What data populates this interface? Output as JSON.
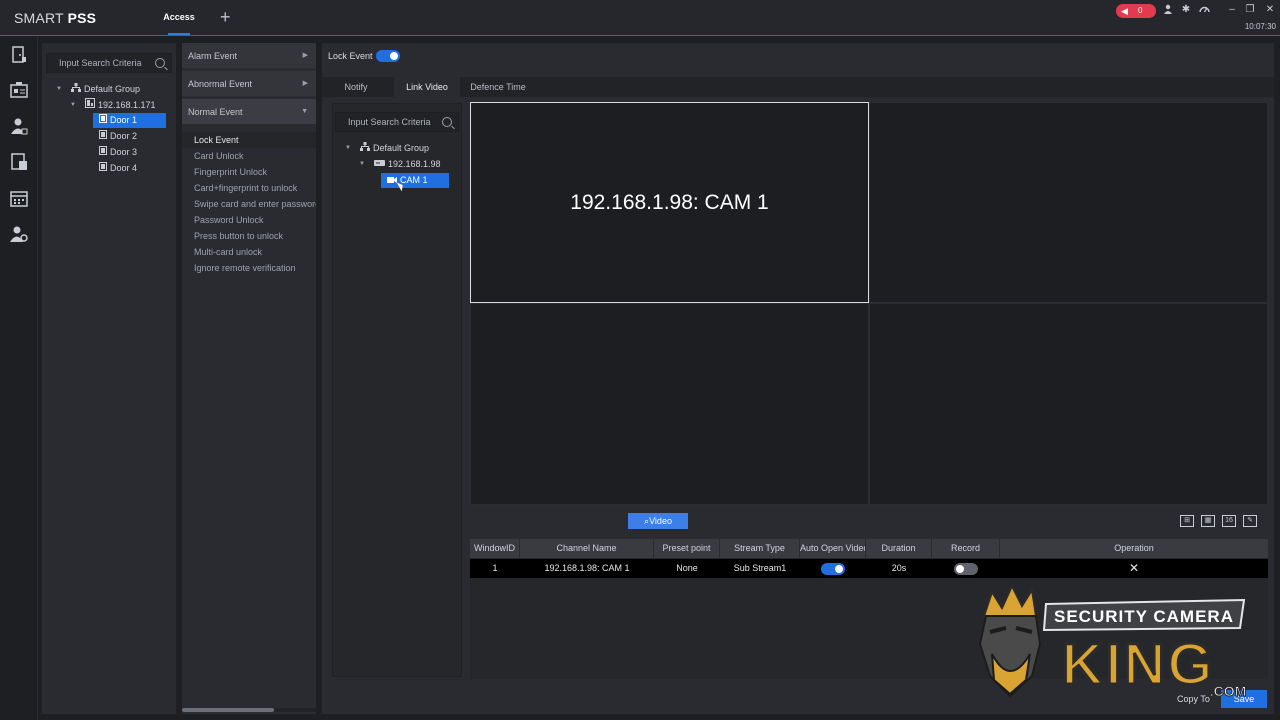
{
  "app": {
    "title_prefix": "SMART",
    "title_suffix": "PSS",
    "active_tab": "Access",
    "alarm_count": "0",
    "time": "10:07:30"
  },
  "device_tree": {
    "search_placeholder": "Input Search Criteria",
    "group": "Default Group",
    "device": "192.168.1.171",
    "doors": [
      "Door 1",
      "Door 2",
      "Door 3",
      "Door 4"
    ]
  },
  "event_panel": {
    "categories": [
      "Alarm Event",
      "Abnormal Event",
      "Normal Event"
    ],
    "items": [
      "Lock Event",
      "Card Unlock",
      "Fingerprint Unlock",
      "Card+fingerprint to unlock",
      "Swipe card and enter password",
      "Password Unlock",
      "Press button to unlock",
      "Multi-card unlock",
      "Ignore remote verification"
    ]
  },
  "main": {
    "lock_event_label": "Lock Event",
    "lock_event_enabled": true,
    "tabs": [
      "Notify",
      "Link Video",
      "Defence Time"
    ],
    "active_tab": "Link Video"
  },
  "camera_tree": {
    "search_placeholder": "Input Search Criteria",
    "group": "Default Group",
    "device": "192.168.1.98",
    "channel": "CAM 1"
  },
  "video_grid": {
    "window1_label": "192.168.1.98: CAM 1"
  },
  "toolbar": {
    "video_button": "Video",
    "layout_16_label": "16"
  },
  "table": {
    "headers": [
      "WindowID",
      "Channel Name",
      "Preset point",
      "Stream Type",
      "Auto Open Video",
      "Duration",
      "Record",
      "Operation"
    ],
    "rows": [
      {
        "window_id": "1",
        "channel": "192.168.1.98: CAM 1",
        "preset": "None",
        "stream": "Sub Stream1",
        "auto_open": true,
        "duration": "20s",
        "record": false
      }
    ]
  },
  "footer": {
    "copy_to": "Copy To",
    "save": "Save"
  },
  "watermark": {
    "line1": "SECURITY CAMERA",
    "line2": "KING",
    "line3": ".COM"
  },
  "colors": {
    "accent": "#1f6fe0",
    "alarm": "#e23a4e",
    "logo_gold": "#d9a431"
  }
}
